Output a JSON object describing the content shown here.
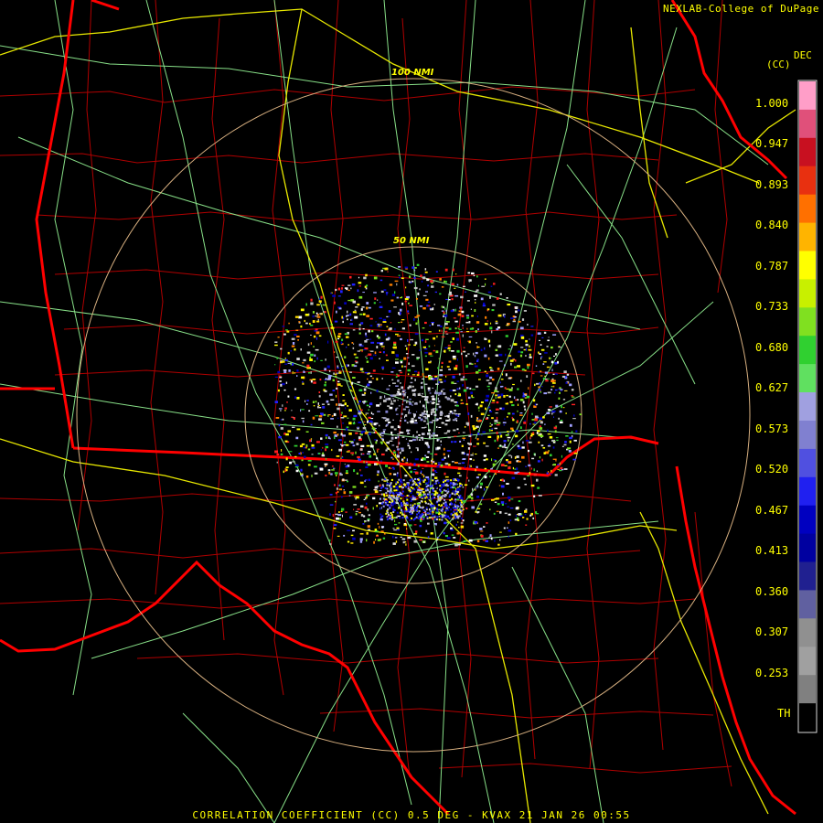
{
  "credit": "NEXLAB-College of DuPage",
  "product_label": "CORRELATION COEFFICIENT (CC) 0.5 DEG - KVAX 21 JAN 26 00:55",
  "range_rings": [
    {
      "label": "50 NMI"
    },
    {
      "label": "100 NMI"
    }
  ],
  "colorbar": {
    "units_top": "DEC",
    "units_bottom": "(CC)",
    "ticks": [
      "1.000",
      "0.947",
      "0.893",
      "0.840",
      "0.787",
      "0.733",
      "0.680",
      "0.627",
      "0.573",
      "0.520",
      "0.467",
      "0.413",
      "0.360",
      "0.307",
      "0.253",
      "TH"
    ],
    "colors": [
      "#ff9ec8",
      "#e0507a",
      "#c81020",
      "#e83010",
      "#ff7000",
      "#ffb400",
      "#ffff00",
      "#c8f000",
      "#80e020",
      "#30d030",
      "#60e060",
      "#a0a0e0",
      "#8080d0",
      "#5050e0",
      "#2020f0",
      "#0000c0",
      "#0000a0",
      "#202090",
      "#6060a0",
      "#909090",
      "#a0a0a0",
      "#808080",
      "#000000"
    ]
  },
  "layers": {
    "state_border_color": "#ff0000",
    "county_color": "#c80000",
    "highway_color": "#ffff00",
    "road_color": "#90e890",
    "ring_color": "#d8b080"
  }
}
